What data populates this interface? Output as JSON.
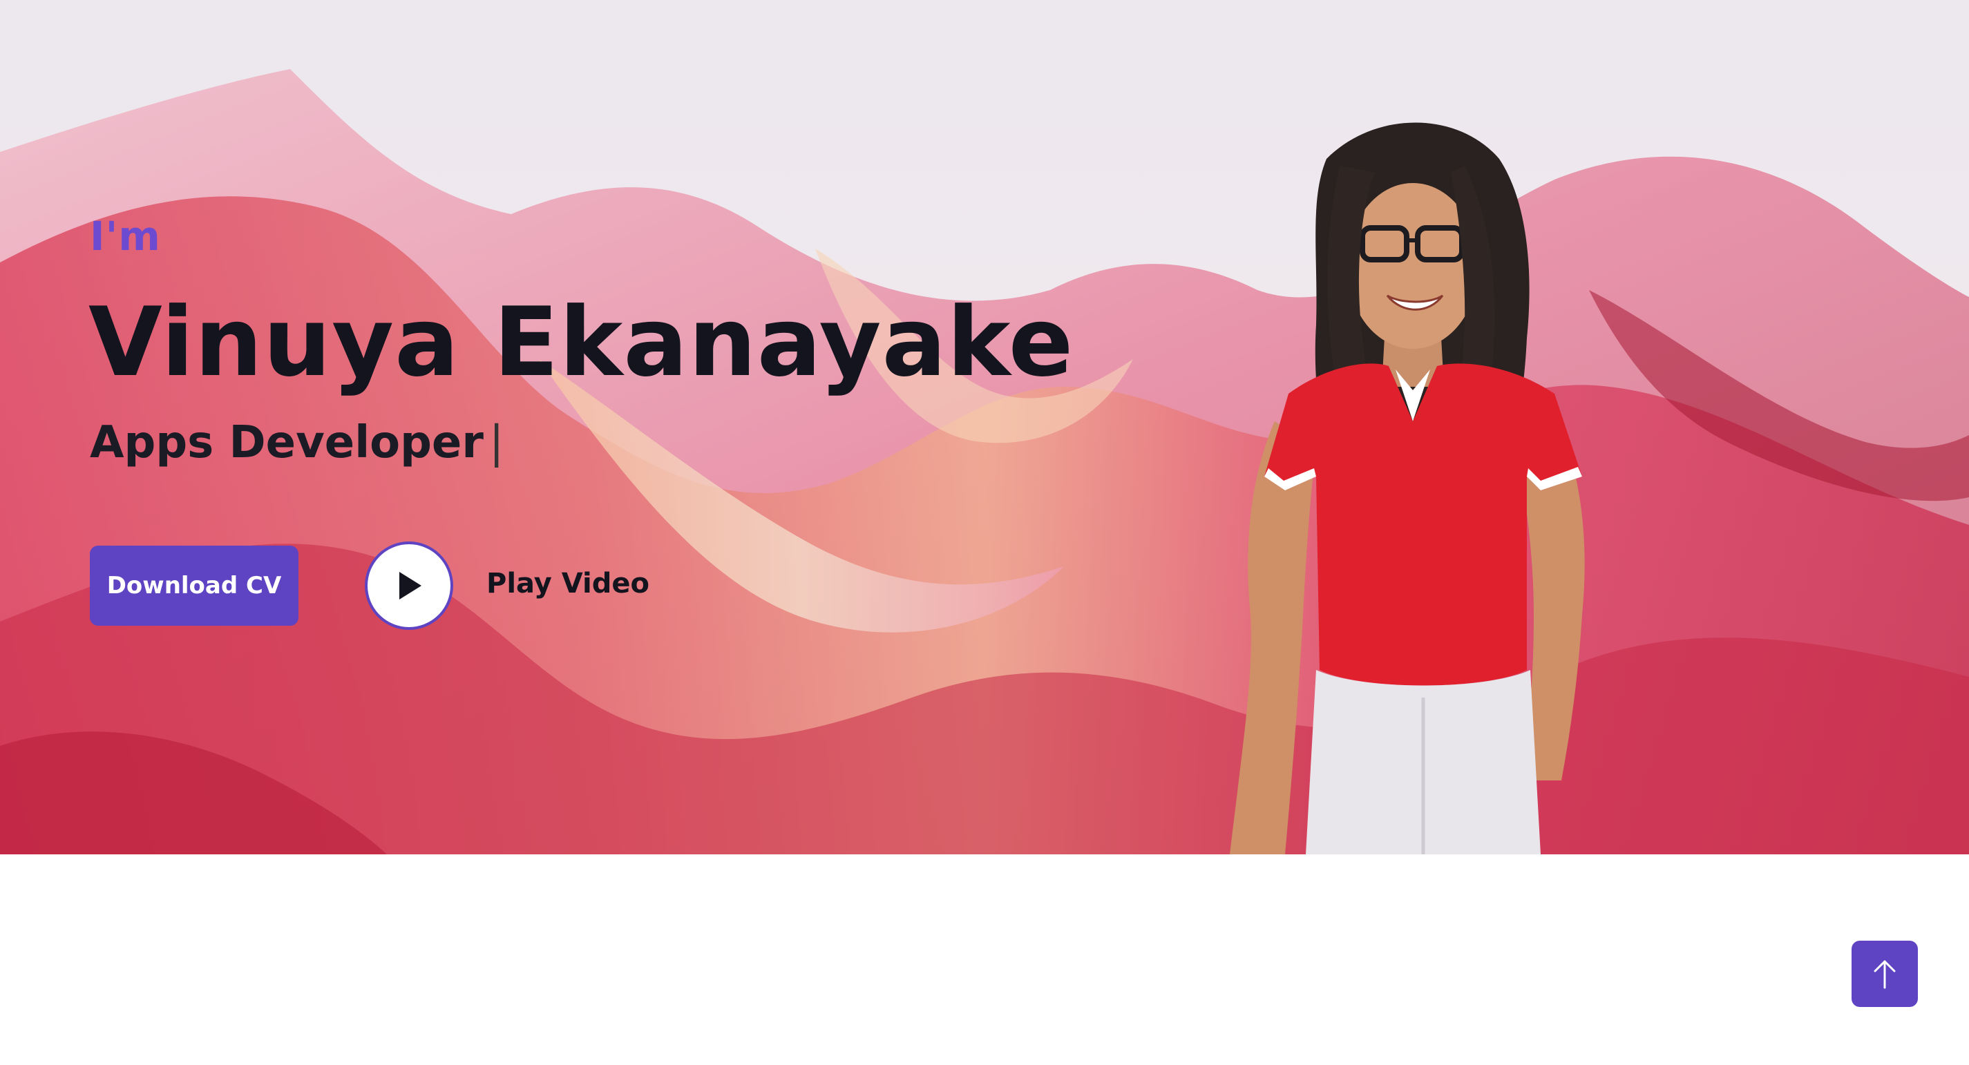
{
  "hero": {
    "intro": "I'm",
    "name": "Vinuya Ekanayake",
    "role": "Apps Developer",
    "cursor": "|",
    "download_label": "Download CV",
    "play_label": "Play Video"
  },
  "icons": {
    "play": "play-icon",
    "scroll_top": "arrow-up-icon"
  },
  "colors": {
    "accent": "#5e43c2",
    "heading": "#14141e",
    "intro": "#6c4bd0",
    "background": "#ffffff"
  }
}
